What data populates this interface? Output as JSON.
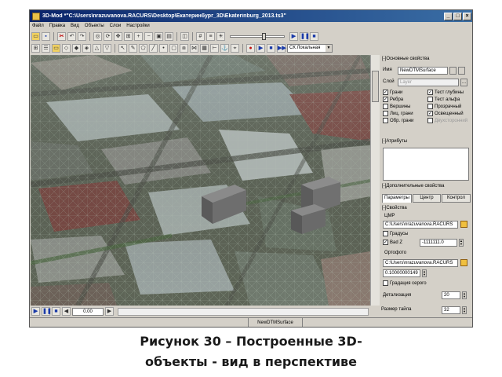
{
  "window": {
    "title": "3D-Mod *\"C:\\Users\\nrazuvanova.RACURS\\Desktop\\Екатеринбург_3D\\Ekaterinburg_2013.ts3\""
  },
  "menu": [
    "Файл",
    "Правка",
    "Вид",
    "Объекты",
    "Слои",
    "Настройки"
  ],
  "toolbar": {
    "coordinate_system": "СК Локальная"
  },
  "panel": {
    "basic_header": "[-]Основные свойства",
    "name_label": "Имя",
    "name_value": "NewDTMSurface",
    "layer_label": "Слой",
    "layer_value": "Layer",
    "layer_btn": "...",
    "checks_left": [
      {
        "label": "Грани",
        "checked": true
      },
      {
        "label": "Ребра",
        "checked": true
      },
      {
        "label": "Вершины",
        "checked": false
      },
      {
        "label": "Лиц. грани",
        "checked": false
      },
      {
        "label": "Обр. грани",
        "checked": false
      }
    ],
    "checks_right": [
      {
        "label": "Тест глубины",
        "checked": true
      },
      {
        "label": "Тест альфа",
        "checked": false
      },
      {
        "label": "Прозрачный",
        "checked": false
      },
      {
        "label": "Освещенный",
        "checked": true
      },
      {
        "label": "Двухсторонний",
        "checked": false
      }
    ],
    "attributes_header": "[-]Атрибуты",
    "extra_header": "[-]Дополнительные свойства",
    "tabs": [
      "Параметры",
      "Центр",
      "Контрол"
    ],
    "props_header": "[-]Свойства",
    "dem_label": "ЦМР",
    "dem_path": "C:\\Users\\nrazuvanova.RACURS",
    "degrees_label": "Градусы",
    "badz_label": "Bad Z",
    "badz_value": "-1111111.0",
    "ortho_label": "Ортофото",
    "ortho_path": "C:\\Users\\nrazuvanova.RACURS",
    "ortho_value": "0.10000000149",
    "gray_label": "Градация серого",
    "detail_label": "Детализация",
    "detail_value": "20",
    "tile_label": "Размер тайла",
    "tile_value": "32"
  },
  "statusbar": {
    "frame_value": "0.00",
    "object_name": "NewDTMSurface"
  },
  "caption": {
    "line1": "Рисунок 30 – Построенные 3D-",
    "line2": "объекты - вид в перспективе"
  },
  "colors": {
    "title_bar": "#0a246a",
    "panel_bg": "#d4d0c8",
    "aerial_ground": "#5f6658",
    "roof_light": "#a8b0ac",
    "building_3d": "#6c6c6c"
  },
  "icons": [
    "open-icon",
    "save-icon",
    "undo-icon",
    "redo-icon",
    "select-icon",
    "play-icon",
    "pause-icon",
    "stop-icon",
    "record-icon",
    "folder-icon",
    "close-icon",
    "maximize-icon",
    "minimize-icon"
  ]
}
